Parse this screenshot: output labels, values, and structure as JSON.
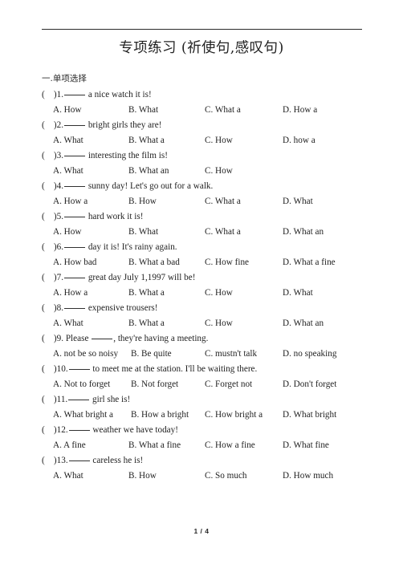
{
  "document": {
    "title": "专项练习 (祈使句,感叹句)",
    "section_heading": "一.单项选择",
    "footer_page": "1 / 4"
  },
  "questions": [
    {
      "marker": "(    )1.",
      "stem_before": "",
      "stem_after": " a nice watch it is!",
      "options": {
        "a": "A. How",
        "b": "B. What",
        "c": "C. What a",
        "d": "D. How a"
      }
    },
    {
      "marker": "(    )2.",
      "stem_before": "",
      "stem_after": " bright girls they are!",
      "options": {
        "a": "A. What",
        "b": "B. What a",
        "c": "C. How",
        "d": "D. how a"
      }
    },
    {
      "marker": "(    )3.",
      "stem_before": "",
      "stem_after": " interesting the film is!",
      "options": {
        "a": "A. What",
        "b": "B. What an",
        "c": "C. How",
        "d": ""
      }
    },
    {
      "marker": "(    )4.",
      "stem_before": "",
      "stem_after": " sunny day! Let's go out for a walk.",
      "options": {
        "a": "A. How a",
        "b": "B. How",
        "c": "C. What a",
        "d": "D. What"
      }
    },
    {
      "marker": "(    )5.",
      "stem_before": "",
      "stem_after": " hard work it is!",
      "options": {
        "a": "A. How",
        "b": "B. What",
        "c": "C. What a",
        "d": "D. What an"
      }
    },
    {
      "marker": "(    )6.",
      "stem_before": "",
      "stem_after": " day it is! It's rainy again.",
      "options": {
        "a": "A. How bad",
        "b": "B. What a bad",
        "c": "C. How fine",
        "d": "D. What a fine"
      }
    },
    {
      "marker": "(    )7.",
      "stem_before": "",
      "stem_after": " great day July 1,1997 will be!",
      "options": {
        "a": "A. How a",
        "b": "B. What a",
        "c": "C. How",
        "d": "D. What"
      }
    },
    {
      "marker": "(    )8.",
      "stem_before": "",
      "stem_after": " expensive trousers!",
      "options": {
        "a": "A. What",
        "b": "B. What a",
        "c": "C. How",
        "d": "D. What an"
      }
    },
    {
      "marker": "(    )9.",
      "stem_before": " Please ",
      "stem_after": ", they're having a meeting.",
      "options": {
        "a": "A. not be so noisy",
        "b": "B. Be quite",
        "c": "C. mustn't talk",
        "d": "D. no speaking"
      }
    },
    {
      "marker": "(    )10.",
      "stem_before": "",
      "stem_after": " to meet me at the station. I'll be waiting there.",
      "options": {
        "a": "A. Not to forget",
        "b": "B. Not forget",
        "c": "C. Forget not",
        "d": "D. Don't forget"
      }
    },
    {
      "marker": "(    )11.",
      "stem_before": "",
      "stem_after": " girl she is!",
      "options": {
        "a": "A. What bright a",
        "b": "B. How a bright",
        "c": "C. How bright a",
        "d": "D. What bright"
      }
    },
    {
      "marker": "(    )12.",
      "stem_before": "",
      "stem_after": " weather we have today!",
      "options": {
        "a": "A. A fine",
        "b": "B. What a fine",
        "c": "C. How a fine",
        "d": "D. What fine"
      }
    },
    {
      "marker": "(    )13.",
      "stem_before": "",
      "stem_after": " careless he is!",
      "options": {
        "a": "A. What",
        "b": "B. How",
        "c": "C. So much",
        "d": "D. How much"
      }
    }
  ]
}
